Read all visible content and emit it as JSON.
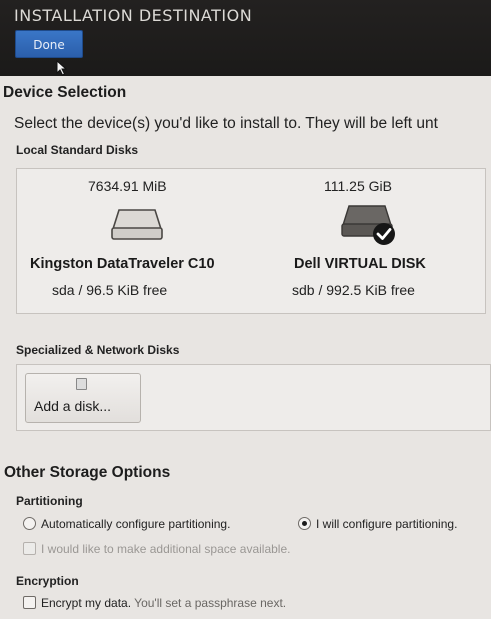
{
  "header": {
    "title": "INSTALLATION DESTINATION",
    "done_label": "Done"
  },
  "device_selection": {
    "heading": "Device Selection",
    "subtitle": "Select the device(s) you'd like to install to.  They will be left unt",
    "local_heading": "Local Standard Disks",
    "disks": [
      {
        "size": "7634.91 MiB",
        "name": "Kingston DataTraveler C10",
        "info": "sda   /   96.5 KiB free",
        "selected": false
      },
      {
        "size": "111.25 GiB",
        "name": "Dell VIRTUAL DISK",
        "info": "sdb / 992.5 KiB free",
        "selected": true
      }
    ],
    "specialized_heading": "Specialized & Network Disks",
    "add_disk_label": "Add a disk..."
  },
  "other_storage": {
    "heading": "Other Storage Options",
    "partitioning_heading": "Partitioning",
    "auto_label": "Automatically configure partitioning.",
    "manual_label": "I will configure partitioning.",
    "selected_option": "manual",
    "additional_space_label": "I would like to make additional space available.",
    "encryption_heading": "Encryption",
    "encrypt_label": "Encrypt my data.",
    "encrypt_note": "You'll set a passphrase next."
  },
  "colors": {
    "header_bg": "#1b1a19",
    "done_button": "#2b5fab",
    "page_bg": "#e8e5e2"
  }
}
